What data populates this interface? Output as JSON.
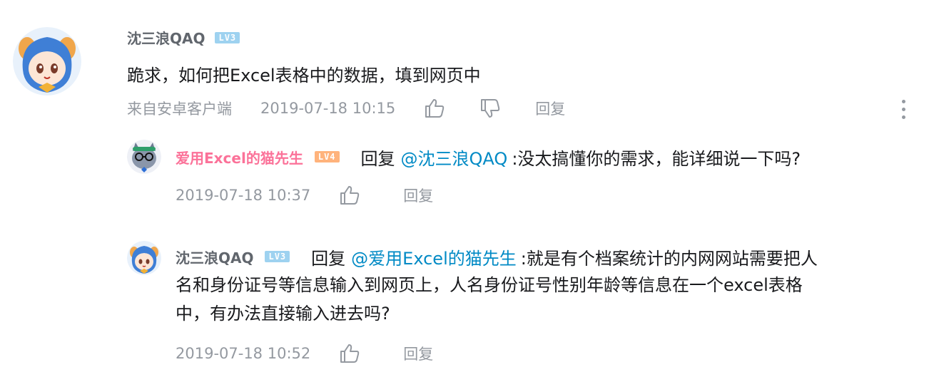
{
  "main_comment": {
    "username": "沈三浪QAQ",
    "level": "LV3",
    "text": "跪求，如何把Excel表格中的数据，填到网页中",
    "device": "来自安卓客户端",
    "time": "2019-07-18 10:15",
    "reply_label": "回复"
  },
  "replies": [
    {
      "username": "爱用Excel的猫先生",
      "level": "LV4",
      "reply_prefix": "回复",
      "mention": "@沈三浪QAQ",
      "text": ":没太搞懂你的需求，能详细说一下吗?",
      "time": "2019-07-18 10:37",
      "reply_label": "回复"
    },
    {
      "username": "沈三浪QAQ",
      "level": "LV3",
      "reply_prefix": "回复",
      "mention": "@爱用Excel的猫先生",
      "text_line1": ":就是有个档案统计的内网网站需要把人",
      "text_line2": "名和身份证号等信息输入到网页上，人名身份证号性别年龄等信息在一个excel表格",
      "text_line3": "中，有办法直接输入进去吗?",
      "time": "2019-07-18 10:52",
      "reply_label": "回复"
    }
  ],
  "colors": {
    "vip_name": "#fb7299",
    "mention": "#008ac5",
    "meta": "#9499a0",
    "level3": "#9ed2f0",
    "level4": "#ffb37c"
  },
  "icons": {
    "like": "thumbs-up-icon",
    "dislike": "thumbs-down-icon",
    "more": "more-vertical-icon"
  }
}
